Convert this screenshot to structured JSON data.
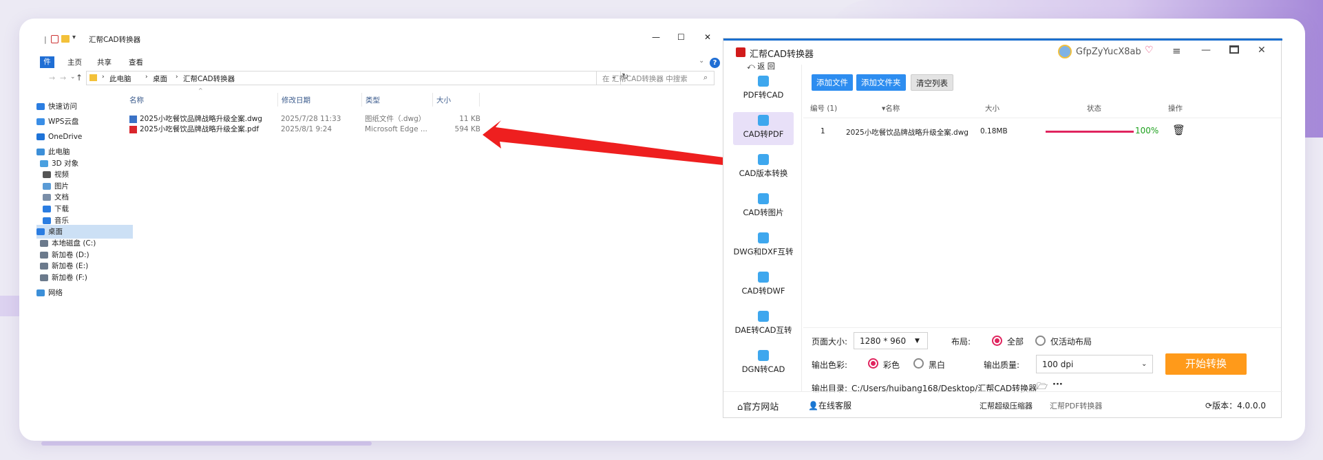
{
  "explorer": {
    "title": "汇帮CAD转换器",
    "controls": {
      "minimize": "—",
      "maximize": "☐",
      "close": "✕"
    },
    "ribbon_tabs": [
      "件",
      "主页",
      "共享",
      "查看"
    ],
    "breadcrumb": [
      "此电脑",
      "桌面",
      "汇帮CAD转换器"
    ],
    "search_placeholder": "在 汇帮CAD转换器 中搜索",
    "nav": [
      {
        "label": "快速访问",
        "color": "#2b7de1"
      },
      {
        "label": "WPS云盘",
        "color": "#3a8ee6"
      },
      {
        "label": "OneDrive",
        "color": "#1e73d8"
      },
      {
        "label": "此电脑",
        "color": "#3c8fd8"
      },
      {
        "label": "3D 对象",
        "color": "#4aa0e0"
      },
      {
        "label": "视频",
        "color": "#555"
      },
      {
        "label": "图片",
        "color": "#5a9bd6"
      },
      {
        "label": "文档",
        "color": "#7a8ea8"
      },
      {
        "label": "下载",
        "color": "#2b7de1"
      },
      {
        "label": "音乐",
        "color": "#2b7de1"
      },
      {
        "label": "桌面",
        "color": "#2b7de1"
      },
      {
        "label": "本地磁盘 (C:)",
        "color": "#6b7a8c"
      },
      {
        "label": "新加卷 (D:)",
        "color": "#6b7a8c"
      },
      {
        "label": "新加卷 (E:)",
        "color": "#6b7a8c"
      },
      {
        "label": "新加卷 (F:)",
        "color": "#6b7a8c"
      },
      {
        "label": "网络",
        "color": "#3c8fd8"
      }
    ],
    "columns": {
      "name": "名称",
      "date": "修改日期",
      "type": "类型",
      "size": "大小"
    },
    "files": [
      {
        "name": "2025小吃餐饮品牌战略升级全案.dwg",
        "date": "2025/7/28 11:33",
        "type": "图纸文件（.dwg）",
        "size": "11 KB",
        "icon": "dwg-icon"
      },
      {
        "name": "2025小吃餐饮品牌战略升级全案.pdf",
        "date": "2025/8/1 9:24",
        "type": "Microsoft Edge ...",
        "size": "594 KB",
        "icon": "pdf-icon"
      }
    ]
  },
  "converter": {
    "title": "汇帮CAD转换器",
    "user": "GfpZyYucX8ab",
    "back": "返 回",
    "sidebar": [
      "PDF转CAD",
      "CAD转PDF",
      "CAD版本转换",
      "CAD转图片",
      "DWG和DXF互转",
      "CAD转DWF",
      "DAE转CAD互转",
      "DGN转CAD"
    ],
    "active_index": 1,
    "toolbar": {
      "add_file": "添加文件",
      "add_folder": "添加文件夹",
      "clear": "清空列表"
    },
    "table": {
      "headers": [
        "编号 (1)",
        "名称",
        "大小",
        "状态",
        "操作"
      ],
      "rows": [
        {
          "index": "1",
          "name": "2025小吃餐饮品牌战略升级全案.dwg",
          "size": "0.18MB",
          "progress": 1.0,
          "progress_label": "100%"
        }
      ]
    },
    "options": {
      "page_size_label": "页面大小:",
      "page_size_value": "1280 * 960",
      "layout_label": "布局:",
      "layout_all": "全部",
      "layout_active": "仅活动布局",
      "color_label": "输出色彩:",
      "color_color": "彩色",
      "color_bw": "黑白",
      "quality_label": "输出质量:",
      "quality_value": "100 dpi",
      "start_button": "开始转换",
      "output_dir_label": "输出目录:",
      "output_dir_value": "C:/Users/huibang168/Desktop/汇帮CAD转换器"
    },
    "footer": {
      "website": "官方网站",
      "service": "在线客服",
      "link1": "汇帮超级压缩器",
      "link2": "汇帮PDF转换器",
      "version": "版本：4.0.0.0"
    },
    "accent": "#1a6fd0",
    "progress_color": "#e0245e",
    "start_color": "#ff9a1a"
  }
}
